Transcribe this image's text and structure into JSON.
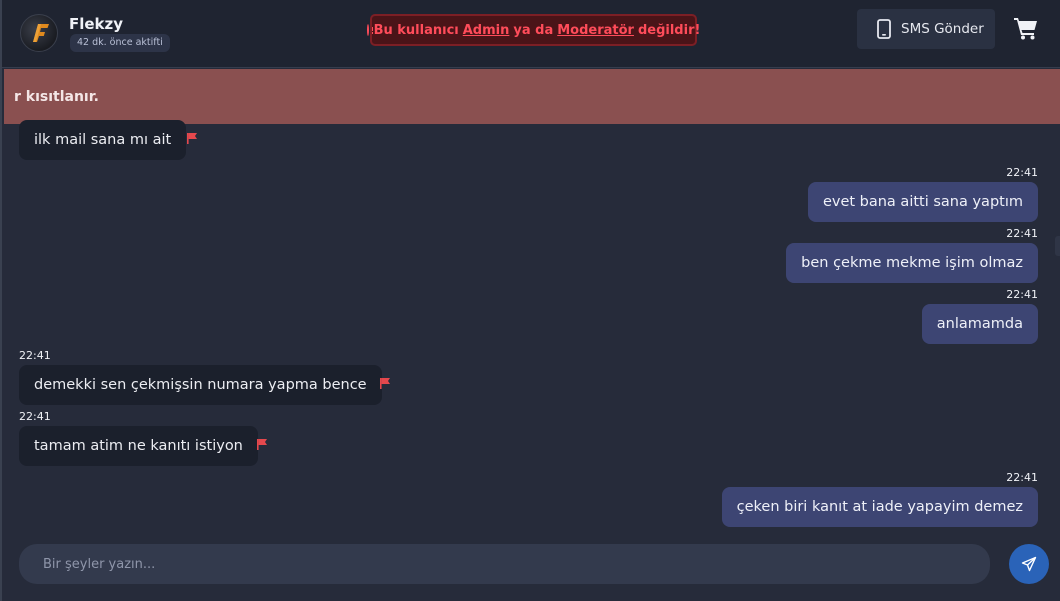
{
  "header": {
    "user_name": "Flekzy",
    "last_seen": "42 dk. önce aktifti",
    "warning": {
      "prefix": "Bu kullanıcı",
      "link1": "Admin",
      "middle": "ya da",
      "link2": "Moderatör",
      "suffix": "değildir!"
    },
    "sms_button": "SMS Gönder",
    "icons": {
      "avatar": "user-avatar-icon",
      "warning": "alert-circle-icon",
      "phone": "phone-icon",
      "cart": "cart-icon"
    }
  },
  "banner": {
    "text": "r kısıtlanır."
  },
  "messages": [
    {
      "direction": "in",
      "time": "",
      "text": "ilk mail sana mı ait"
    },
    {
      "direction": "out",
      "time": "22:41",
      "text": "evet bana aitti sana yaptım"
    },
    {
      "direction": "out",
      "time": "22:41",
      "text": "ben çekme mekme işim olmaz"
    },
    {
      "direction": "out",
      "time": "22:41",
      "text": "anlamamda"
    },
    {
      "direction": "in",
      "time": "22:41",
      "text": "demekki sen çekmişsin numara yapma bence"
    },
    {
      "direction": "in",
      "time": "22:41",
      "text": "tamam atim ne kanıtı istiyon"
    },
    {
      "direction": "out",
      "time": "22:41",
      "text": "çeken biri kanıt at iade yapayim demez"
    }
  ],
  "composer": {
    "placeholder": "Bir şeyler yazın...",
    "value": ""
  },
  "colors": {
    "outgoing_bubble": "#3d4573",
    "incoming_bubble": "#1b202c",
    "warning_text": "#ff4c5a",
    "flag": "#e5484d",
    "send_button": "#2a63b8",
    "banner": "#8a5050"
  }
}
